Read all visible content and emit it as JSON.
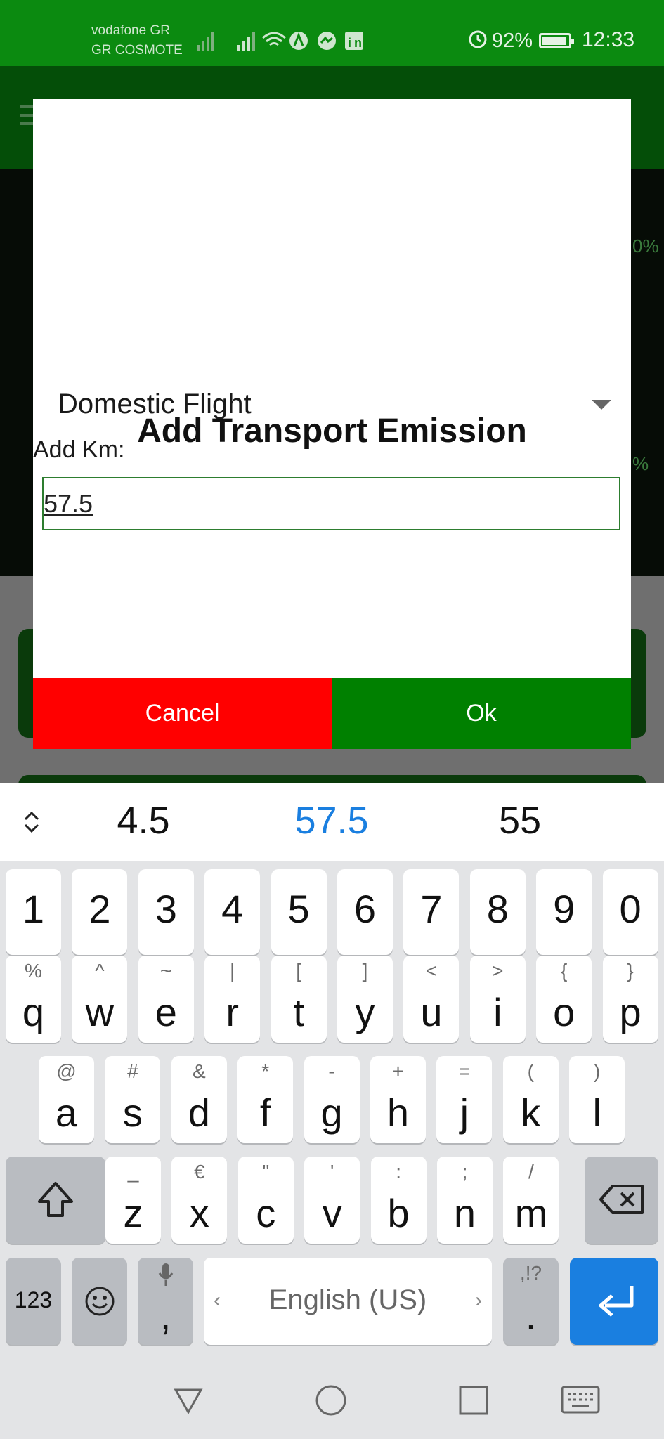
{
  "status_bar": {
    "carrier_line1": "vodafone GR",
    "carrier_line2": "GR COSMOTE",
    "battery": "92%",
    "time": "12:33",
    "icons": [
      "signal-icon",
      "signal-icon",
      "wifi-icon",
      "app-icon",
      "messenger-icon",
      "linkedin-icon",
      "alarm-icon",
      "battery-icon"
    ]
  },
  "background_app": {
    "percent_a": "0%",
    "percent_b": "%"
  },
  "dialog": {
    "title": "Add Transport Emission",
    "transport_type": "Domestic Flight",
    "km_label": "Add Km:",
    "km_value": "57.5",
    "cancel_label": "Cancel",
    "ok_label": "Ok"
  },
  "keyboard": {
    "suggestions": [
      "4.5",
      "57.5",
      "55"
    ],
    "suggestion_highlight_color": "#1a7fe0",
    "number_row": [
      "1",
      "2",
      "3",
      "4",
      "5",
      "6",
      "7",
      "8",
      "9",
      "0"
    ],
    "row1": [
      {
        "k": "q",
        "s": "%"
      },
      {
        "k": "w",
        "s": "^"
      },
      {
        "k": "e",
        "s": "~"
      },
      {
        "k": "r",
        "s": "|"
      },
      {
        "k": "t",
        "s": "["
      },
      {
        "k": "y",
        "s": "]"
      },
      {
        "k": "u",
        "s": "<"
      },
      {
        "k": "i",
        "s": ">"
      },
      {
        "k": "o",
        "s": "{"
      },
      {
        "k": "p",
        "s": "}"
      }
    ],
    "row2": [
      {
        "k": "a",
        "s": "@"
      },
      {
        "k": "s",
        "s": "#"
      },
      {
        "k": "d",
        "s": "&"
      },
      {
        "k": "f",
        "s": "*"
      },
      {
        "k": "g",
        "s": "-"
      },
      {
        "k": "h",
        "s": "+"
      },
      {
        "k": "j",
        "s": "="
      },
      {
        "k": "k",
        "s": "("
      },
      {
        "k": "l",
        "s": ")"
      }
    ],
    "row3": [
      {
        "k": "z",
        "s": "_"
      },
      {
        "k": "x",
        "s": "€"
      },
      {
        "k": "c",
        "s": "\""
      },
      {
        "k": "v",
        "s": "'"
      },
      {
        "k": "b",
        "s": ":"
      },
      {
        "k": "n",
        "s": ";"
      },
      {
        "k": "m",
        "s": "/"
      }
    ],
    "symbols_label": "123",
    "comma_label": ",",
    "space_label": "English (US)",
    "period_label": ".",
    "period_sub": ",!?",
    "enter_color": "#1a7fe0"
  }
}
